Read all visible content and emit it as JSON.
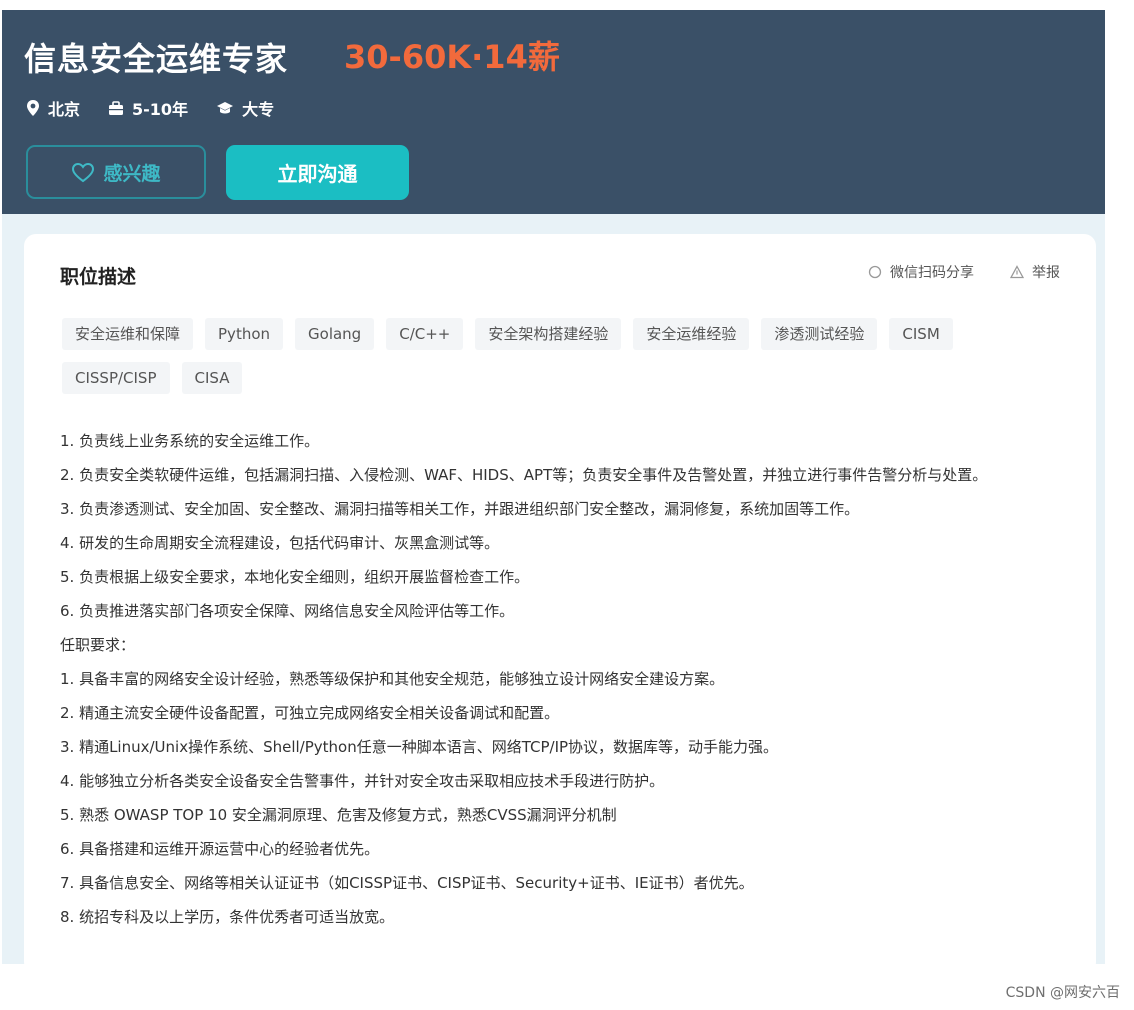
{
  "header": {
    "title": "信息安全运维专家",
    "salary": "30-60K·14薪",
    "meta": {
      "location": "北京",
      "experience": "5-10年",
      "education": "大专"
    },
    "interest_label": "感兴趣",
    "chat_label": "立即沟通"
  },
  "card": {
    "section_title": "职位描述",
    "share_label": "微信扫码分享",
    "report_label": "举报",
    "tags": [
      "安全运维和保障",
      "Python",
      "Golang",
      "C/C++",
      "安全架构搭建经验",
      "安全运维经验",
      "渗透测试经验",
      "CISM",
      "CISSP/CISP",
      "CISA"
    ],
    "description_lines": [
      "1. 负责线上业务系统的安全运维工作。",
      "2. 负责安全类软硬件运维，包括漏洞扫描、入侵检测、WAF、HIDS、APT等；负责安全事件及告警处置，并独立进行事件告警分析与处置。",
      "3. 负责渗透测试、安全加固、安全整改、漏洞扫描等相关工作，并跟进组织部门安全整改，漏洞修复，系统加固等工作。",
      "4. 研发的生命周期安全流程建设，包括代码审计、灰黑盒测试等。",
      "5. 负责根据上级安全要求，本地化安全细则，组织开展监督检查工作。",
      "6. 负责推进落实部门各项安全保障、网络信息安全风险评估等工作。",
      "任职要求：",
      "1. 具备丰富的网络安全设计经验，熟悉等级保护和其他安全规范，能够独立设计网络安全建设方案。",
      "2. 精通主流安全硬件设备配置，可独立完成网络安全相关设备调试和配置。",
      "3. 精通Linux/Unix操作系统、Shell/Python任意一种脚本语言、网络TCP/IP协议，数据库等，动手能力强。",
      "4. 能够独立分析各类安全设备安全告警事件，并针对安全攻击采取相应技术手段进行防护。",
      "5. 熟悉 OWASP TOP 10 安全漏洞原理、危害及修复方式，熟悉CVSS漏洞评分机制",
      "6. 具备搭建和运维开源运营中心的经验者优先。",
      "7. 具备信息安全、网络等相关认证证书（如CISSP证书、CISP证书、Security+证书、IE证书）者优先。",
      "8. 统招专科及以上学历，条件优秀者可适当放宽。"
    ]
  },
  "watermark": "CSDN @网安六百",
  "colors": {
    "header_bg": "#3a5067",
    "salary": "#f26a3c",
    "chat_button": "#1bbec3",
    "interest_border": "#2a8e9c",
    "content_bg": "#e8f2f7"
  },
  "icons": {
    "location": "location-pin-icon",
    "experience": "briefcase-icon",
    "education": "graduation-cap-icon",
    "interest": "heart-icon",
    "share": "wechat-icon",
    "report": "warning-icon"
  }
}
